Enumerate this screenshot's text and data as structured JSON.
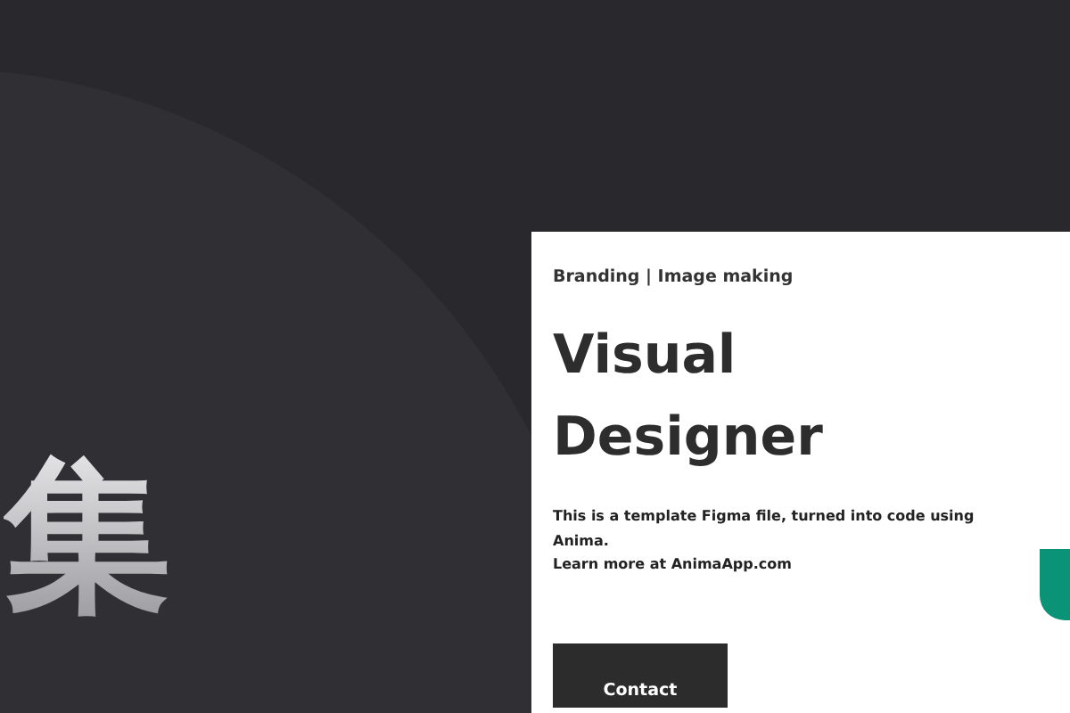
{
  "hero_character": "集",
  "card": {
    "eyebrow": "Branding | Image making",
    "title_lines": [
      "Visual",
      "Designer"
    ],
    "description_lines": [
      "This is a template Figma file, turned into code using Anima.",
      "Learn more at AnimaApp.com"
    ],
    "button": "Contact"
  }
}
